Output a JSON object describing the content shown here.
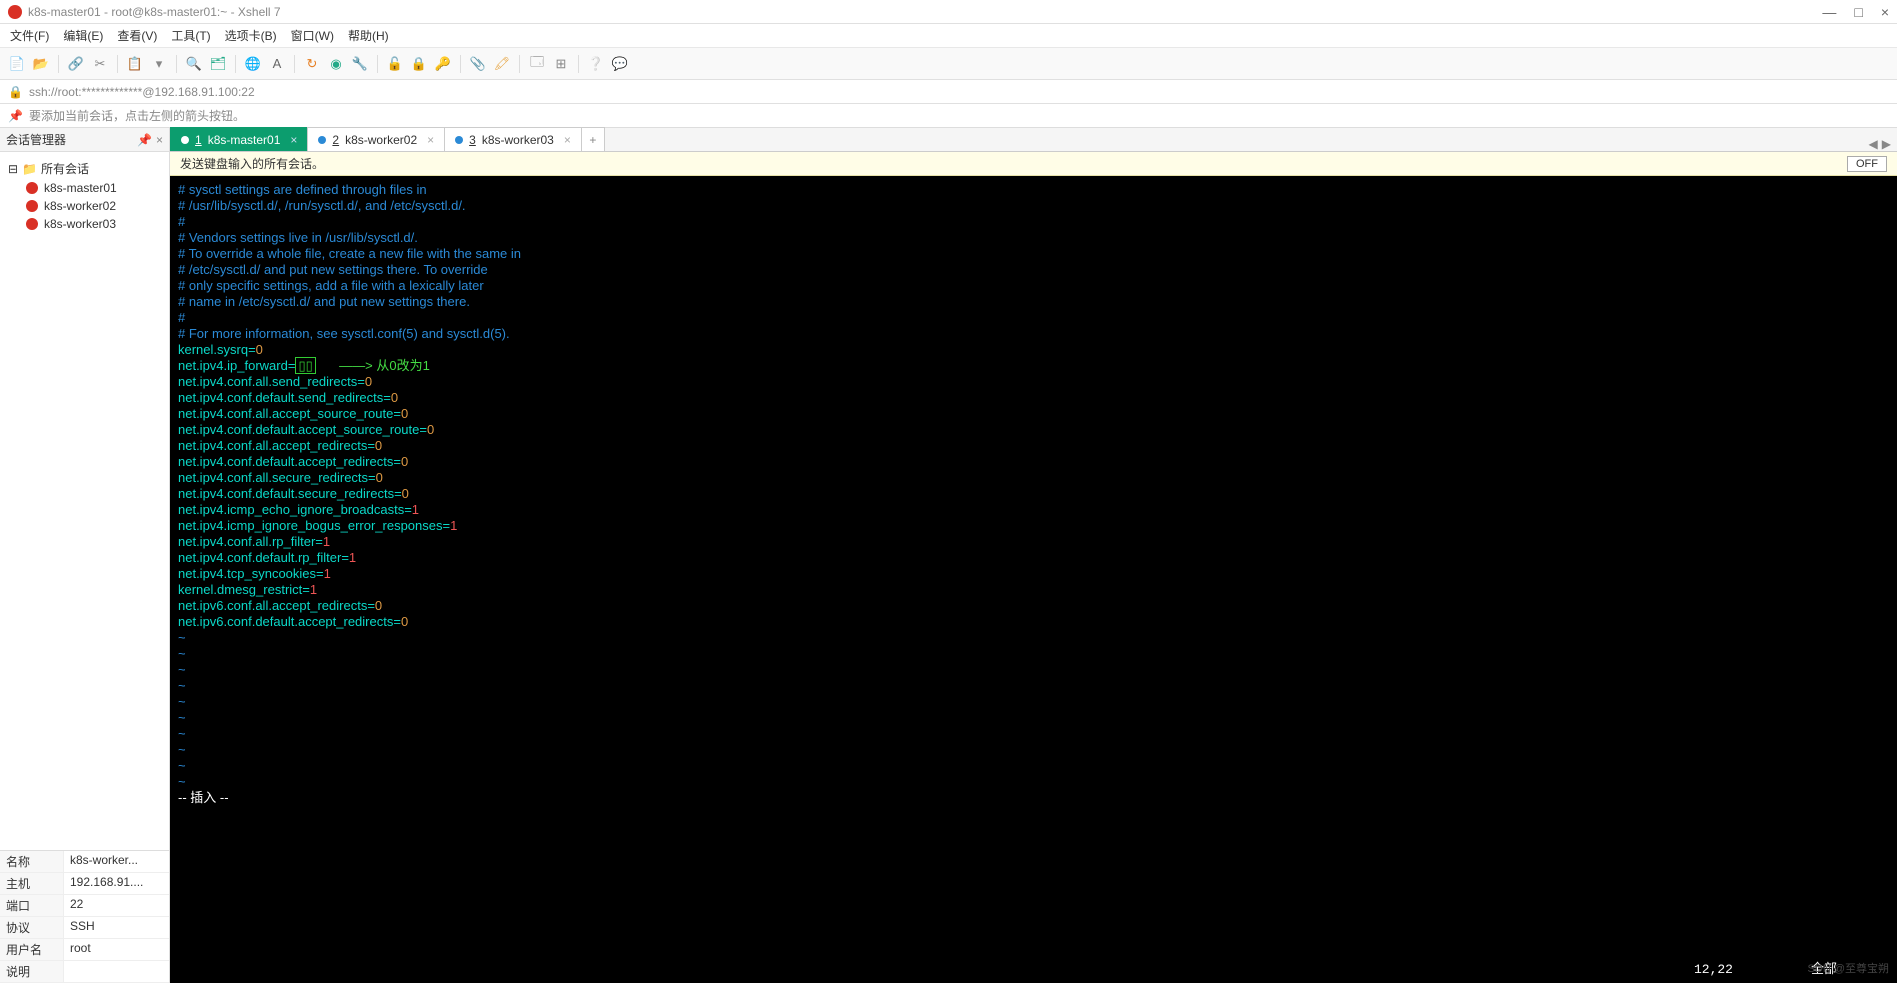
{
  "window": {
    "title": "k8s-master01 - root@k8s-master01:~ - Xshell 7",
    "minimize": "—",
    "maximize": "□",
    "close": "×"
  },
  "menu": {
    "file": "文件(F)",
    "edit": "编辑(E)",
    "view": "查看(V)",
    "tools": "工具(T)",
    "tab": "选项卡(B)",
    "window": "窗口(W)",
    "help": "帮助(H)"
  },
  "address": "ssh://root:*************@192.168.91.100:22",
  "hint": "要添加当前会话，点击左侧的箭头按钮。",
  "sidebar": {
    "title": "会话管理器",
    "root": "所有会话",
    "items": [
      "k8s-master01",
      "k8s-worker02",
      "k8s-worker03"
    ]
  },
  "props": {
    "name_k": "名称",
    "name_v": "k8s-worker...",
    "host_k": "主机",
    "host_v": "192.168.91....",
    "port_k": "端口",
    "port_v": "22",
    "proto_k": "协议",
    "proto_v": "SSH",
    "user_k": "用户名",
    "user_v": "root",
    "desc_k": "说明",
    "desc_v": ""
  },
  "tabs": {
    "t1_num": "1",
    "t1": "k8s-master01",
    "t2_num": "2",
    "t2": "k8s-worker02",
    "t3_num": "3",
    "t3": "k8s-worker03",
    "add": "+"
  },
  "yellow": {
    "text": "发送键盘输入的所有会话。",
    "off": "OFF"
  },
  "term": {
    "c1": "# sysctl settings are defined through files in",
    "c2": "# /usr/lib/sysctl.d/, /run/sysctl.d/, and /etc/sysctl.d/.",
    "c3": "#",
    "c4": "# Vendors settings live in /usr/lib/sysctl.d/.",
    "c5": "# To override a whole file, create a new file with the same in",
    "c6": "# /etc/sysctl.d/ and put new settings there. To override",
    "c7": "# only specific settings, add a file with a lexically later",
    "c8": "# name in /etc/sysctl.d/ and put new settings there.",
    "c9": "#",
    "c10": "# For more information, see sysctl.conf(5) and sysctl.d(5).",
    "k_sysrq": "kernel.sysrq",
    "v_sysrq": "0",
    "k_ipfwd": "net.ipv4.ip_forward",
    "v_ipfwd": "1",
    "box_char": "▯▯",
    "ann": "——> 从0改为1",
    "k_sr": "net.ipv4.conf.all.send_redirects",
    "v_sr": "0",
    "k_dsr": "net.ipv4.conf.default.send_redirects",
    "v_dsr": "0",
    "k_asr": "net.ipv4.conf.all.accept_source_route",
    "v_asr": "0",
    "k_dasr": "net.ipv4.conf.default.accept_source_route",
    "v_dasr": "0",
    "k_aar": "net.ipv4.conf.all.accept_redirects",
    "v_aar": "0",
    "k_dar": "net.ipv4.conf.default.accept_redirects",
    "v_dar": "0",
    "k_asecr": "net.ipv4.conf.all.secure_redirects",
    "v_asecr": "0",
    "k_dsecr": "net.ipv4.conf.default.secure_redirects",
    "v_dsecr": "0",
    "k_icmpb": "net.ipv4.icmp_echo_ignore_broadcasts",
    "v_icmpb": "1",
    "k_icmpe": "net.ipv4.icmp_ignore_bogus_error_responses",
    "v_icmpe": "1",
    "k_rpf": "net.ipv4.conf.all.rp_filter",
    "v_rpf": "1",
    "k_drpf": "net.ipv4.conf.default.rp_filter",
    "v_drpf": "1",
    "k_syn": "net.ipv4.tcp_syncookies",
    "v_syn": "1",
    "k_dmesg": "kernel.dmesg_restrict",
    "v_dmesg": "1",
    "k_v6a": "net.ipv6.conf.all.accept_redirects",
    "v_v6a": "0",
    "k_v6d": "net.ipv6.conf.default.accept_redirects",
    "v_v6d": "0",
    "tilde": "~",
    "insert": "-- 插入 --",
    "pos": "12,22          全部",
    "watermark": "SDN @至尊宝朔"
  }
}
